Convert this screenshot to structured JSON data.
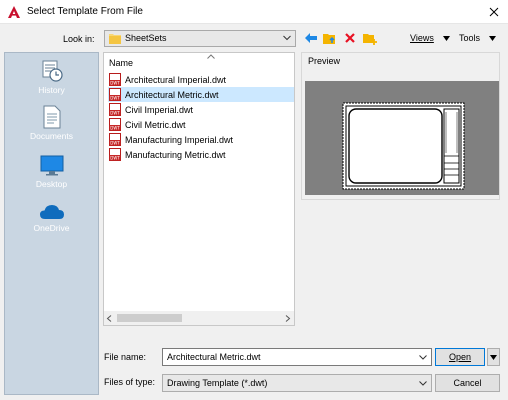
{
  "window": {
    "title": "Select Template From File",
    "app_icon": "autocad-a-icon",
    "close_icon": "close-icon"
  },
  "toolbar": {
    "look_in_label": "Look in:",
    "look_in_value": "SheetSets",
    "icons": [
      "back-arrow-icon",
      "folder-up-icon",
      "delete-icon",
      "new-folder-icon"
    ],
    "views_label": "Views",
    "tools_label": "Tools"
  },
  "places": [
    {
      "label": "History",
      "icon": "history-icon"
    },
    {
      "label": "Documents",
      "icon": "documents-icon"
    },
    {
      "label": "Desktop",
      "icon": "desktop-icon"
    },
    {
      "label": "OneDrive",
      "icon": "onedrive-cloud-icon"
    }
  ],
  "file_list": {
    "column_header": "Name",
    "files": [
      {
        "name": "Architectural Imperial.dwt"
      },
      {
        "name": "Architectural Metric.dwt",
        "selected": true
      },
      {
        "name": "Civil Imperial.dwt"
      },
      {
        "name": "Civil Metric.dwt"
      },
      {
        "name": "Manufacturing Imperial.dwt"
      },
      {
        "name": "Manufacturing Metric.dwt"
      }
    ]
  },
  "preview": {
    "label": "Preview"
  },
  "form": {
    "file_name_label": "File name:",
    "file_name_value": "Architectural Metric.dwt",
    "files_of_type_label": "Files of type:",
    "files_of_type_value": "Drawing Template (*.dwt)",
    "open_label": "Open",
    "cancel_label": "Cancel"
  },
  "colors": {
    "selection": "#cce8ff",
    "places_bg": "#c9d6e2",
    "preview_bg": "#808080",
    "accent_blue": "#0078d7",
    "delete_red": "#e81123",
    "folder_yellow": "#f4b400"
  }
}
